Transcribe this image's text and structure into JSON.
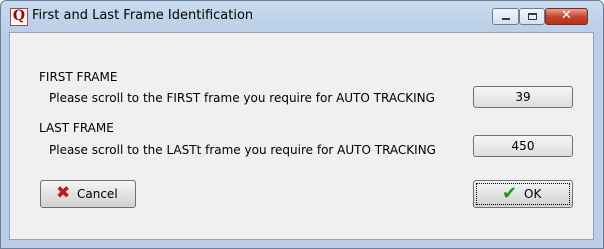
{
  "window": {
    "title": "First and Last Frame Identification",
    "app_icon_letter": "Q",
    "close_glyph": "✕"
  },
  "first_frame": {
    "heading": "FIRST FRAME",
    "instruction": "Please scroll to the FIRST frame you require for AUTO TRACKING",
    "value": "39"
  },
  "last_frame": {
    "heading": "LAST FRAME",
    "instruction": "Please scroll to the LASTt frame you require for AUTO TRACKING",
    "value": "450"
  },
  "buttons": {
    "cancel_label": "Cancel",
    "cancel_icon": "x-icon",
    "ok_label": "OK",
    "ok_icon": "checkmark-icon"
  },
  "colors": {
    "cancel_icon": "#c21a1a",
    "ok_icon": "#1f9b1f",
    "close_button": "#c74630"
  }
}
